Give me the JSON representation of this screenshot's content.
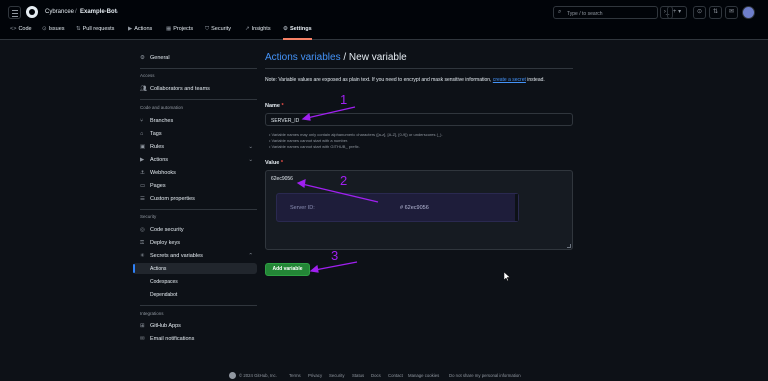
{
  "header": {
    "owner": "Cybrancee",
    "separator": "/",
    "repo": "Example-Bot",
    "search_placeholder": "Type / to search",
    "icons": [
      "hamburger-icon",
      "github-logo",
      "lock-icon",
      "search-icon",
      "command-palette-icon",
      "plus-icon",
      "issues-icon",
      "pull-requests-icon",
      "inbox-icon",
      "avatar"
    ]
  },
  "tabs": [
    {
      "icon": "<>",
      "label": "Code"
    },
    {
      "icon": "⊙",
      "label": "Issues"
    },
    {
      "icon": "⇅",
      "label": "Pull requests"
    },
    {
      "icon": "▶",
      "label": "Actions"
    },
    {
      "icon": "▦",
      "label": "Projects"
    },
    {
      "icon": "⛉",
      "label": "Security"
    },
    {
      "icon": "↗",
      "label": "Insights"
    },
    {
      "icon": "⚙",
      "label": "Settings"
    }
  ],
  "sidebar": {
    "general": "General",
    "access_heading": "Access",
    "collaborators": "Collaborators and teams",
    "code_heading": "Code and automation",
    "branches": "Branches",
    "tags": "Tags",
    "rules": "Rules",
    "actions": "Actions",
    "webhooks": "Webhooks",
    "pages": "Pages",
    "custom_properties": "Custom properties",
    "security_heading": "Security",
    "code_security": "Code security",
    "deploy_keys": "Deploy keys",
    "secrets_variables": "Secrets and variables",
    "sub_actions": "Actions",
    "sub_codespaces": "Codespaces",
    "sub_dependabot": "Dependabot",
    "integrations_heading": "Integrations",
    "github_apps": "GitHub Apps",
    "email_notifications": "Email notifications"
  },
  "main": {
    "title_link": "Actions variables",
    "title_rest": " / New variable",
    "note_prefix": "Note: Variable values are exposed as plain text. If you need to encrypt and mask sensitive information, ",
    "note_link": "create a secret",
    "note_suffix": " instead.",
    "name_label": "Name",
    "required": "*",
    "name_value": "SERVER_ID",
    "hint1": "• Variable names may only contain alphanumeric characters ([a-z], [A-Z], [0-9]) or underscores (_).",
    "hint2": "• Variable names cannot start with a number.",
    "hint3": "• Variable names cannot start with GITHUB_ prefix.",
    "value_label": "Value",
    "value_value": "62ec9056",
    "pasted_label": "Server ID:",
    "pasted_value": "# 62ec9056",
    "add_button": "Add variable"
  },
  "annotations": {
    "one": "1",
    "two": "2",
    "three": "3",
    "color": "#a020f0"
  },
  "footer": {
    "copyright": "© 2024 GitHub, Inc.",
    "links": [
      "Terms",
      "Privacy",
      "Security",
      "Status",
      "Docs",
      "Contact",
      "Manage cookies",
      "Do not share my personal information"
    ]
  }
}
